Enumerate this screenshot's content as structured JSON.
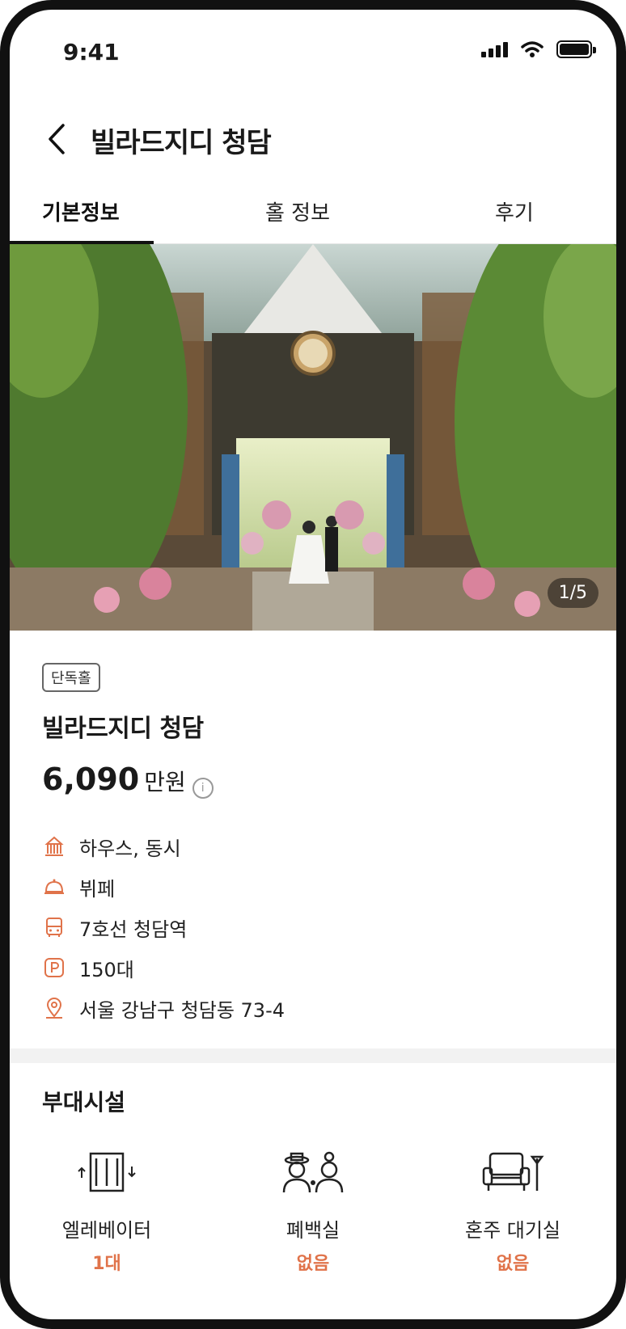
{
  "status_bar": {
    "time": "9:41"
  },
  "header": {
    "title": "빌라드지디 청담",
    "back_icon": "chevron-left-icon"
  },
  "tabs": [
    {
      "label": "기본정보",
      "active": true
    },
    {
      "label": "홀 정보",
      "active": false
    },
    {
      "label": "후기",
      "active": false
    }
  ],
  "gallery": {
    "counter": "1/5",
    "current": 1,
    "total": 5
  },
  "venue": {
    "badge": "단독홀",
    "name": "빌라드지디 청담",
    "price_amount": "6,090",
    "price_unit": "만원",
    "details": [
      {
        "icon": "building-icon",
        "text": "하우스, 동시"
      },
      {
        "icon": "food-cloche-icon",
        "text": "뷔페"
      },
      {
        "icon": "bus-icon",
        "text": "7호선 청담역"
      },
      {
        "icon": "parking-icon",
        "text": "150대"
      },
      {
        "icon": "location-pin-icon",
        "text": "서울 강남구 청담동 73-4"
      }
    ]
  },
  "facilities": {
    "title": "부대시설",
    "items": [
      {
        "icon": "elevator-icon",
        "label": "엘레베이터",
        "value": "1대"
      },
      {
        "icon": "couple-icon",
        "label": "폐백실",
        "value": "없음"
      },
      {
        "icon": "armchair-icon",
        "label": "혼주 대기실",
        "value": "없음"
      }
    ]
  },
  "colors": {
    "accent": "#e0734a",
    "text": "#1a1a1a",
    "divider": "#f2f2f2"
  }
}
